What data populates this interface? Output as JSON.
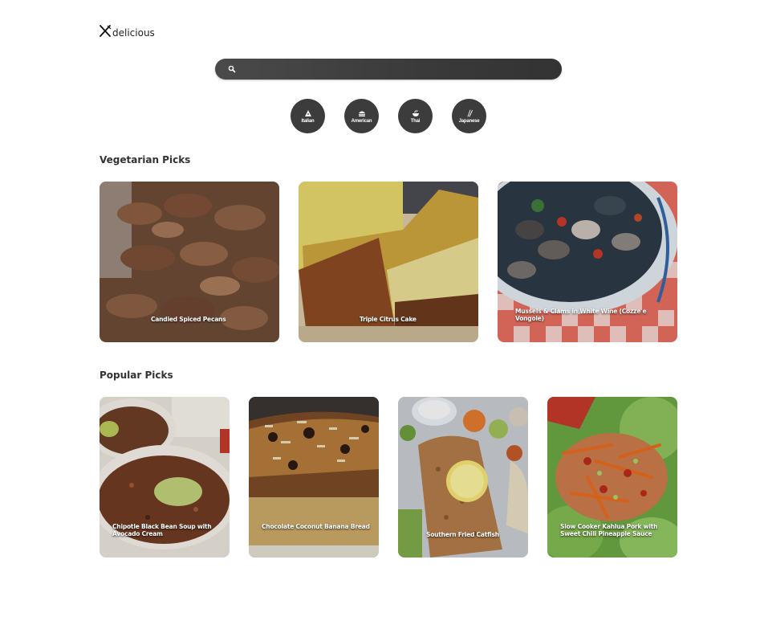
{
  "brand": {
    "name": "delicious",
    "logo_icon": "fork-knife-icon"
  },
  "search": {
    "icon": "search-icon",
    "value": "",
    "placeholder": ""
  },
  "cuisines": [
    {
      "label": "Italian",
      "icon": "pizza-icon"
    },
    {
      "label": "American",
      "icon": "burger-icon"
    },
    {
      "label": "Thai",
      "icon": "noodle-bowl-icon"
    },
    {
      "label": "Japanese",
      "icon": "chopsticks-icon"
    }
  ],
  "vegetarian": {
    "title": "Vegetarian Picks",
    "items": [
      {
        "title": "Candied Spiced Pecans"
      },
      {
        "title": "Triple Citrus Cake"
      },
      {
        "title": "Mussels & Clams in White Wine (Cozze e Vongole)"
      }
    ]
  },
  "popular": {
    "title": "Popular Picks",
    "items": [
      {
        "title": "Chipotle Black Bean Soup with Avocado Cream"
      },
      {
        "title": "Chocolate Coconut Banana Bread"
      },
      {
        "title": "Southern Fried Catfish"
      },
      {
        "title": "Slow Cooker Kahlua Pork with Sweet Chili Pineapple Sauce"
      }
    ]
  }
}
